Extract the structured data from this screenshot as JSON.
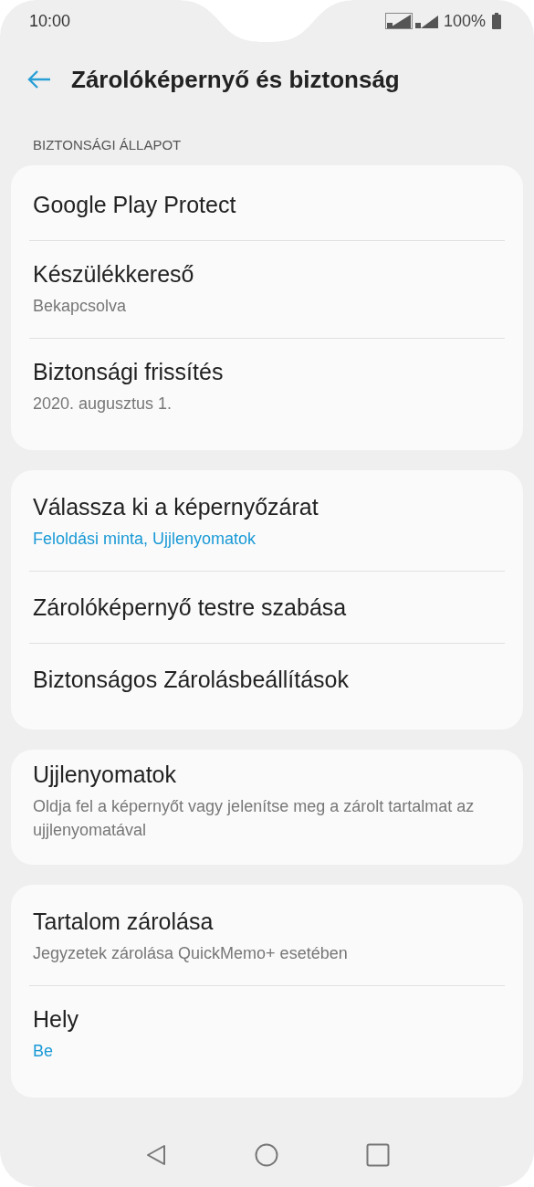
{
  "status_bar": {
    "time": "10:00",
    "battery": "100%"
  },
  "header": {
    "title": "Zárolóképernyő és biztonság"
  },
  "section_label": "BIZTONSÁGI ÁLLAPOT",
  "cards": [
    {
      "items": [
        {
          "title": "Google Play Protect"
        },
        {
          "title": "Készülékkereső",
          "subtitle": "Bekapcsolva",
          "highlighted": false
        },
        {
          "title": "Biztonsági frissítés",
          "subtitle": "2020. augusztus 1.",
          "highlighted": false
        }
      ]
    },
    {
      "items": [
        {
          "title": "Válassza ki a képernyőzárat",
          "subtitle": "Feloldási minta, Ujjlenyomatok",
          "highlighted": true
        },
        {
          "title": "Zárolóképernyő testre szabása"
        },
        {
          "title": "Biztonságos Zárolásbeállítások"
        }
      ]
    },
    {
      "items": [
        {
          "title": "Ujjlenyomatok",
          "subtitle": "Oldja fel a képernyőt vagy jelenítse meg a zárolt tartalmat az ujjlenyomatával",
          "highlighted": false
        }
      ]
    },
    {
      "items": [
        {
          "title": "Tartalom zárolása",
          "subtitle": "Jegyzetek zárolása QuickMemo+ esetében",
          "highlighted": false
        },
        {
          "title": "Hely",
          "subtitle": "Be",
          "highlighted": true
        }
      ]
    }
  ]
}
